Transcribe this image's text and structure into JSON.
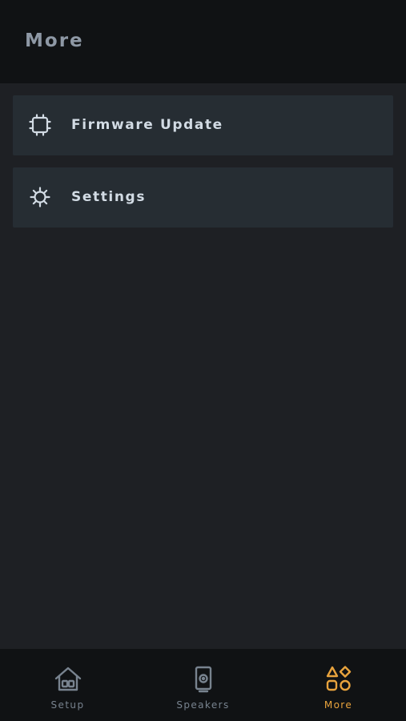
{
  "header": {
    "title": "More"
  },
  "menu": [
    {
      "label": "Firmware Update",
      "icon": "chip-icon"
    },
    {
      "label": "Settings",
      "icon": "gear-icon"
    }
  ],
  "tabbar": {
    "tabs": [
      {
        "label": "Setup",
        "icon": "house-icon",
        "active": false
      },
      {
        "label": "Speakers",
        "icon": "speaker-icon",
        "active": false
      },
      {
        "label": "More",
        "icon": "shapes-icon",
        "active": true
      }
    ]
  },
  "colors": {
    "accent": "#e8a33d",
    "inactive_tab": "#78838f",
    "background": "#1e2024",
    "header_bg": "#101214",
    "card_bg": "#262d33"
  }
}
